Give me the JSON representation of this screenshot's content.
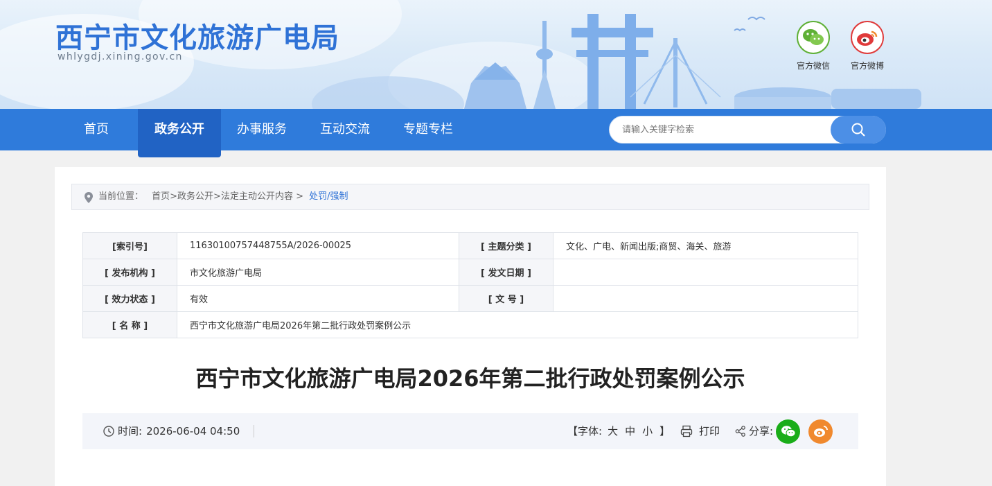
{
  "header": {
    "site_title": "西宁市文化旅游广电局",
    "site_domain": "whlygdj.xining.gov.cn",
    "social": [
      {
        "label": "官方微信",
        "icon": "wechat-icon",
        "color": "#5fb036"
      },
      {
        "label": "官方微博",
        "icon": "weibo-icon",
        "color": "#e03a3a"
      }
    ]
  },
  "nav": {
    "items": [
      {
        "label": "首页"
      },
      {
        "label": "政务公开",
        "active": true
      },
      {
        "label": "办事服务"
      },
      {
        "label": "互动交流"
      },
      {
        "label": "专题专栏"
      }
    ],
    "search_placeholder": "请输入关键字检索"
  },
  "breadcrumb": {
    "prefix": "当前位置：",
    "path": "首页>政务公开>法定主动公开内容 >",
    "current": "处罚/强制"
  },
  "meta": {
    "index_label": "[索引号]",
    "index_value": "11630100757448755A/2026-00025",
    "topic_label": "[ 主题分类 ]",
    "topic_value": "文化、广电、新闻出版;商贸、海关、旅游",
    "publisher_label": "[ 发布机构 ]",
    "publisher_value": "市文化旅游广电局",
    "date_label": "[ 发文日期 ]",
    "date_value": "",
    "status_label": "[ 效力状态 ]",
    "status_value": "有效",
    "docno_label": "[ 文 号 ]",
    "docno_value": "",
    "name_label": "[ 名 称 ]",
    "name_value": "西宁市文化旅游广电局2026年第二批行政处罚案例公示"
  },
  "article": {
    "title": "西宁市文化旅游广电局2026年第二批行政处罚案例公示",
    "time_label": "时间:",
    "time_value": "2026-06-04 04:50",
    "font_label": "【字体:",
    "font_large": "大",
    "font_medium": "中",
    "font_small": "小",
    "font_close": "】",
    "print_label": "打印",
    "share_label": "分享:"
  },
  "colors": {
    "nav_bg": "#2f7bdb",
    "nav_active": "#2163c4",
    "title_blue": "#2f72d6",
    "wechat_green": "#1aad19",
    "weibo_orange": "#f0892e"
  }
}
